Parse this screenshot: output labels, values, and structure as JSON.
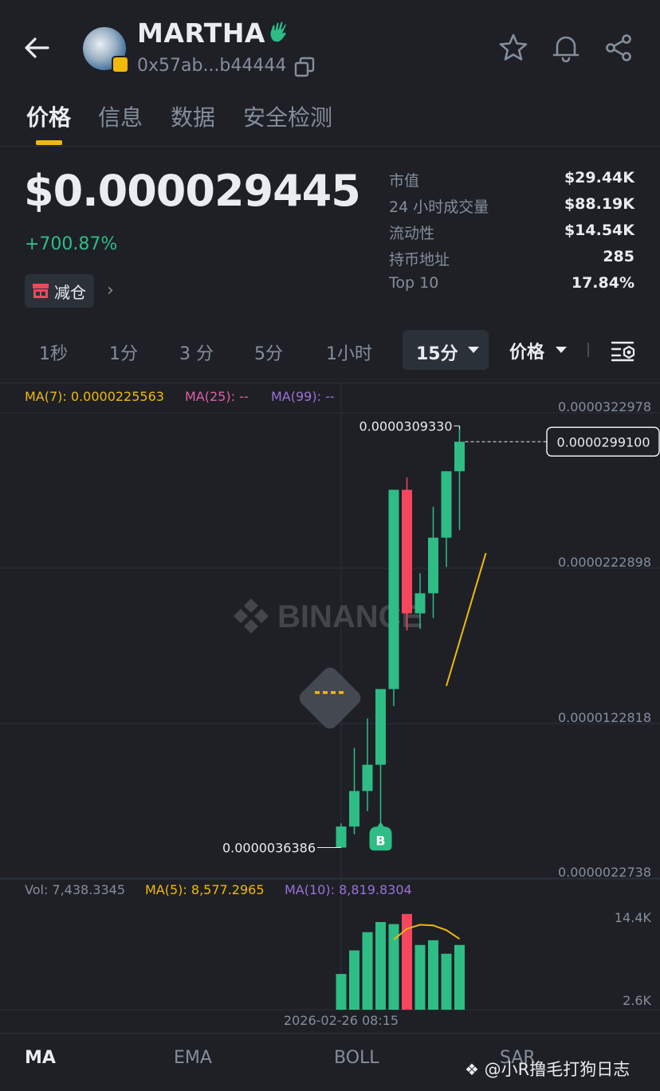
{
  "header": {
    "token_name": "MARTHA",
    "token_address": "0x57ab...b44444"
  },
  "tabs": [
    "价格",
    "信息",
    "数据",
    "安全检测"
  ],
  "price": {
    "value": "$0.000029445",
    "change": "+700.87%",
    "reduce_label": "减仓"
  },
  "stats": [
    {
      "label": "市值",
      "value": "$29.44K"
    },
    {
      "label": "24 小时成交量",
      "value": "$88.19K"
    },
    {
      "label": "流动性",
      "value": "$14.54K"
    },
    {
      "label": "持币地址",
      "value": "285"
    },
    {
      "label": "Top 10",
      "value": "17.84%"
    }
  ],
  "intervals": [
    "1秒",
    "1分",
    "3 分",
    "5分",
    "1小时"
  ],
  "selected_interval": "15分",
  "price_mode": "价格",
  "ma_legend": {
    "ma7": "MA(7): 0.0000225563",
    "ma25": "MA(25): --",
    "ma99": "MA(99): --"
  },
  "vol_legend": {
    "vol": "Vol: 7,438.3345",
    "ma5": "MA(5): 8,577.2965",
    "ma10": "MA(10): 8,819.8304"
  },
  "colors": {
    "up": "#2ebd85",
    "down": "#f6465d",
    "ma7": "#f0b90b",
    "ma25": "#e05fa8",
    "ma99": "#9a72d6"
  },
  "chart_data": {
    "type": "candlestick",
    "y_axis_labels": [
      "0.0000322978",
      "0.0000222898",
      "0.0000122818",
      "0.0000022738"
    ],
    "ylim": [
      2.2738e-06,
      3.22978e-05
    ],
    "high_label": "0.0000309330",
    "low_label": "0.0000036386",
    "current_price_label": "0.0000299100",
    "current_price": 2.991e-05,
    "candles": [
      {
        "o": 3.6386e-06,
        "h": 5.2e-06,
        "l": 3.6386e-06,
        "c": 5e-06
      },
      {
        "o": 5e-06,
        "h": 1.01e-05,
        "l": 4.5e-06,
        "c": 7.3e-06
      },
      {
        "o": 7.3e-06,
        "h": 1.2e-05,
        "l": 6e-06,
        "c": 9e-06
      },
      {
        "o": 9e-06,
        "h": 1.37e-05,
        "l": 5.2e-06,
        "c": 1.39e-05
      },
      {
        "o": 1.39e-05,
        "h": 1.35e-05,
        "l": 1.28e-05,
        "c": 2.68e-05
      },
      {
        "o": 2.68e-05,
        "h": 2.76e-05,
        "l": 1.77e-05,
        "c": 1.88e-05
      },
      {
        "o": 1.88e-05,
        "h": 2.14e-05,
        "l": 1.78e-05,
        "c": 2.01e-05
      },
      {
        "o": 2.01e-05,
        "h": 2.57e-05,
        "l": 1.85e-05,
        "c": 2.37e-05
      },
      {
        "o": 2.37e-05,
        "h": 2.8e-05,
        "l": 2.18e-05,
        "c": 2.8e-05
      },
      {
        "o": 2.8e-05,
        "h": 3.0933e-05,
        "l": 2.42e-05,
        "c": 2.991e-05
      }
    ],
    "ma7_points": [
      [
        8,
        1.41e-05
      ],
      [
        11,
        2.27e-05
      ]
    ],
    "buy_marker": {
      "candle": 3,
      "label": "B"
    },
    "volume": {
      "ylabels": [
        "14.4K",
        "2.6K"
      ],
      "ylim": [
        0,
        15600
      ],
      "values": [
        5300,
        8800,
        11500,
        13000,
        12700,
        14200,
        9600,
        10300,
        8300,
        9600
      ],
      "ma5_points": [
        [
          4,
          10400
        ],
        [
          5,
          12000
        ],
        [
          6,
          12600
        ],
        [
          7,
          12500
        ],
        [
          8,
          11800
        ],
        [
          9,
          10500
        ]
      ]
    },
    "x_label": "2026-02-26 08:15"
  },
  "bottom_tabs": [
    "MA",
    "EMA",
    "BOLL",
    "SAR"
  ],
  "watermark": "BINANCE",
  "credit": "@小R撸毛打狗日志"
}
